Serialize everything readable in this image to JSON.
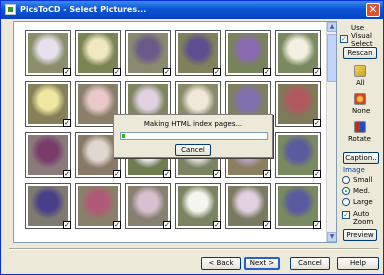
{
  "window": {
    "title": "PicsToCD - Select Pictures...",
    "close_glyph": "✕"
  },
  "gallery": {
    "cells": [
      {
        "c1": "#8a8f6a",
        "c2": "#e8e0ee"
      },
      {
        "c1": "#7a8455",
        "c2": "#f0e8c0"
      },
      {
        "c1": "#8a8a70",
        "c2": "#6a5a8a"
      },
      {
        "c1": "#80805a",
        "c2": "#5e4d90"
      },
      {
        "c1": "#77845a",
        "c2": "#8a6ab0"
      },
      {
        "c1": "#7a8a60",
        "c2": "#f2f0e0"
      },
      {
        "c1": "#85805a",
        "c2": "#f0e8a0"
      },
      {
        "c1": "#8a7f6a",
        "c2": "#e8c8c8"
      },
      {
        "c1": "#7f8660",
        "c2": "#e0d0e0"
      },
      {
        "c1": "#8a8a6a",
        "c2": "#f0e8d8"
      },
      {
        "c1": "#808060",
        "c2": "#8070b0"
      },
      {
        "c1": "#7f7a5a",
        "c2": "#b05a60"
      },
      {
        "c1": "#8a7a7a",
        "c2": "#7a3a6a"
      },
      {
        "c1": "#887a66",
        "c2": "#e0d8d0"
      },
      {
        "c1": "#6e7e50",
        "c2": "#e8e2ea"
      },
      {
        "c1": "#7a8460",
        "c2": "#e0d8d8"
      },
      {
        "c1": "#8a8060",
        "c2": "#b8a0c0"
      },
      {
        "c1": "#7a8a60",
        "c2": "#5a5aa0"
      },
      {
        "c1": "#7f7a70",
        "c2": "#4a3f8a"
      },
      {
        "c1": "#8a7f6a",
        "c2": "#b05a78"
      },
      {
        "c1": "#858070",
        "c2": "#d8c0d0"
      },
      {
        "c1": "#7a8460",
        "c2": "#f5f5f0"
      },
      {
        "c1": "#7a7a60",
        "c2": "#e0d0e0"
      },
      {
        "c1": "#7a8a60",
        "c2": "#5a5aa0"
      }
    ],
    "check_glyph": "✓",
    "scroll_up": "▲",
    "scroll_down": "▼"
  },
  "progress": {
    "message": "Making HTML index pages...",
    "cancel_label": "Cancel",
    "fraction": 0.02
  },
  "side": {
    "use_visual_select": "Use Visual Select",
    "use_visual_select_checked": true,
    "rescan": "Rescan",
    "all": "All",
    "none": "None",
    "rotate": "Rotate",
    "caption": "Caption..",
    "image_size_label": "Image",
    "size_options": [
      "Small",
      "Med.",
      "Large"
    ],
    "size_selected": "Med.",
    "auto_zoom": "Auto Zoom",
    "auto_zoom_checked": true,
    "preview": "Preview"
  },
  "footer": {
    "back": "< Back",
    "next": "Next >",
    "cancel": "Cancel",
    "help": "Help"
  }
}
